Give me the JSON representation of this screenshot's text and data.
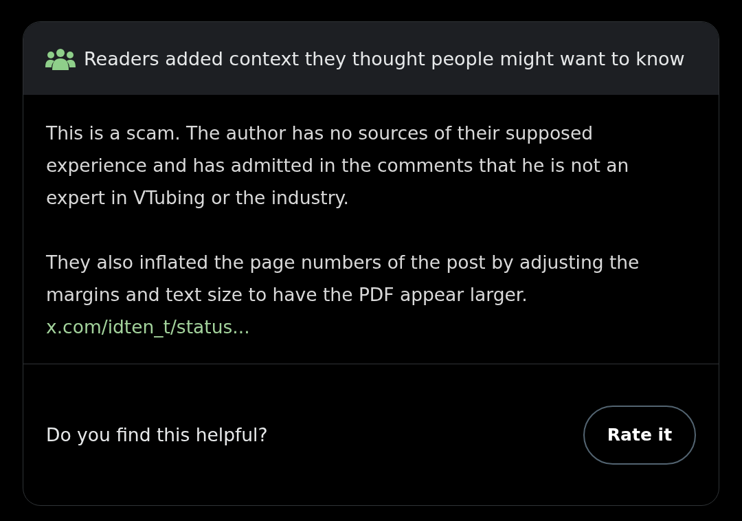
{
  "header": {
    "title": "Readers added context they thought people might want to know"
  },
  "body": {
    "paragraphs": [
      "This is a scam. The author has no sources of their supposed experience and has admitted in the comments that he is not an expert in VTubing or the industry.",
      "They also inflated the page numbers of the post by adjusting the margins and text size to have the PDF appear larger."
    ],
    "link": "x.com/idten_t/status..."
  },
  "footer": {
    "question": "Do you find this helpful?",
    "button": "Rate it"
  }
}
